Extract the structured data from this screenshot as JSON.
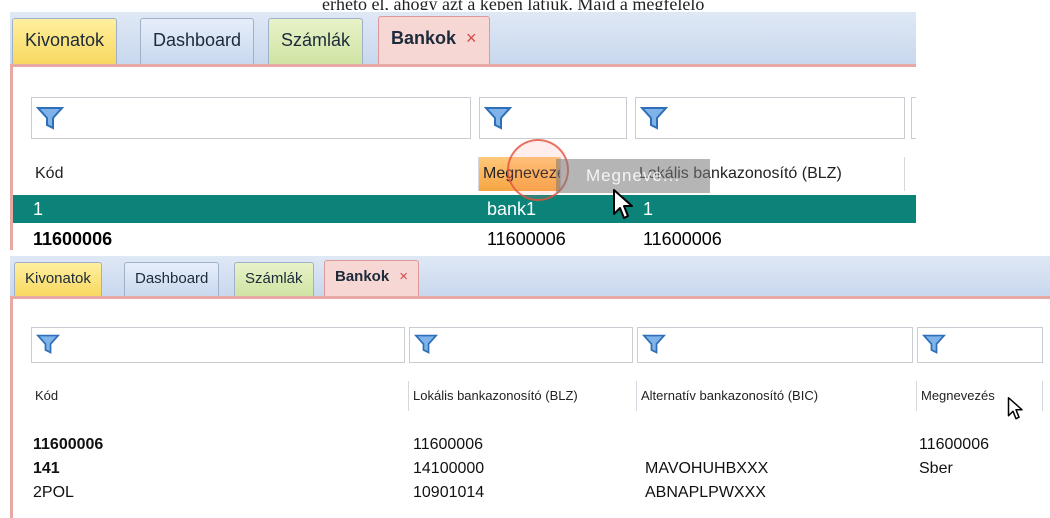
{
  "caption": "érhető el, ahogy azt a képen látjuk. Majd a megfelelő",
  "tabs": {
    "kivonatok": "Kivonatok",
    "dashboard": "Dashboard",
    "szamlak": "Számlák",
    "bankok": "Bankok",
    "close": "×"
  },
  "panel1": {
    "columns": {
      "kod": "Kód",
      "megnevezes": "Megnevezés",
      "blz": "Lokális bankazonosító (BLZ)"
    },
    "drag_ghost": "Megneve...",
    "rows": [
      {
        "kod": "1",
        "megnevezes": "bank1",
        "blz": "1"
      },
      {
        "kod": "11600006",
        "megnevezes": "11600006",
        "blz": "11600006"
      }
    ]
  },
  "panel2": {
    "columns": {
      "kod": "Kód",
      "blz": "Lokális bankazonosító (BLZ)",
      "bic": "Alternatív bankazonosító (BIC)",
      "megnevezes": "Megnevezés"
    },
    "rows": [
      {
        "kod": "11600006",
        "blz": "11600006",
        "bic": "",
        "megnevezes": "11600006"
      },
      {
        "kod": "141",
        "blz": "14100000",
        "bic": "MAVOHUHBXXX",
        "megnevezes": "Sber"
      },
      {
        "kod": "2POL",
        "blz": "10901014",
        "bic": "ABNAPLPWXXX",
        "megnevezes": ""
      }
    ]
  },
  "colors": {
    "selected_row": "#0b8379",
    "active_header": "#f6a643",
    "tab_border_active": "#e8a9a4"
  }
}
